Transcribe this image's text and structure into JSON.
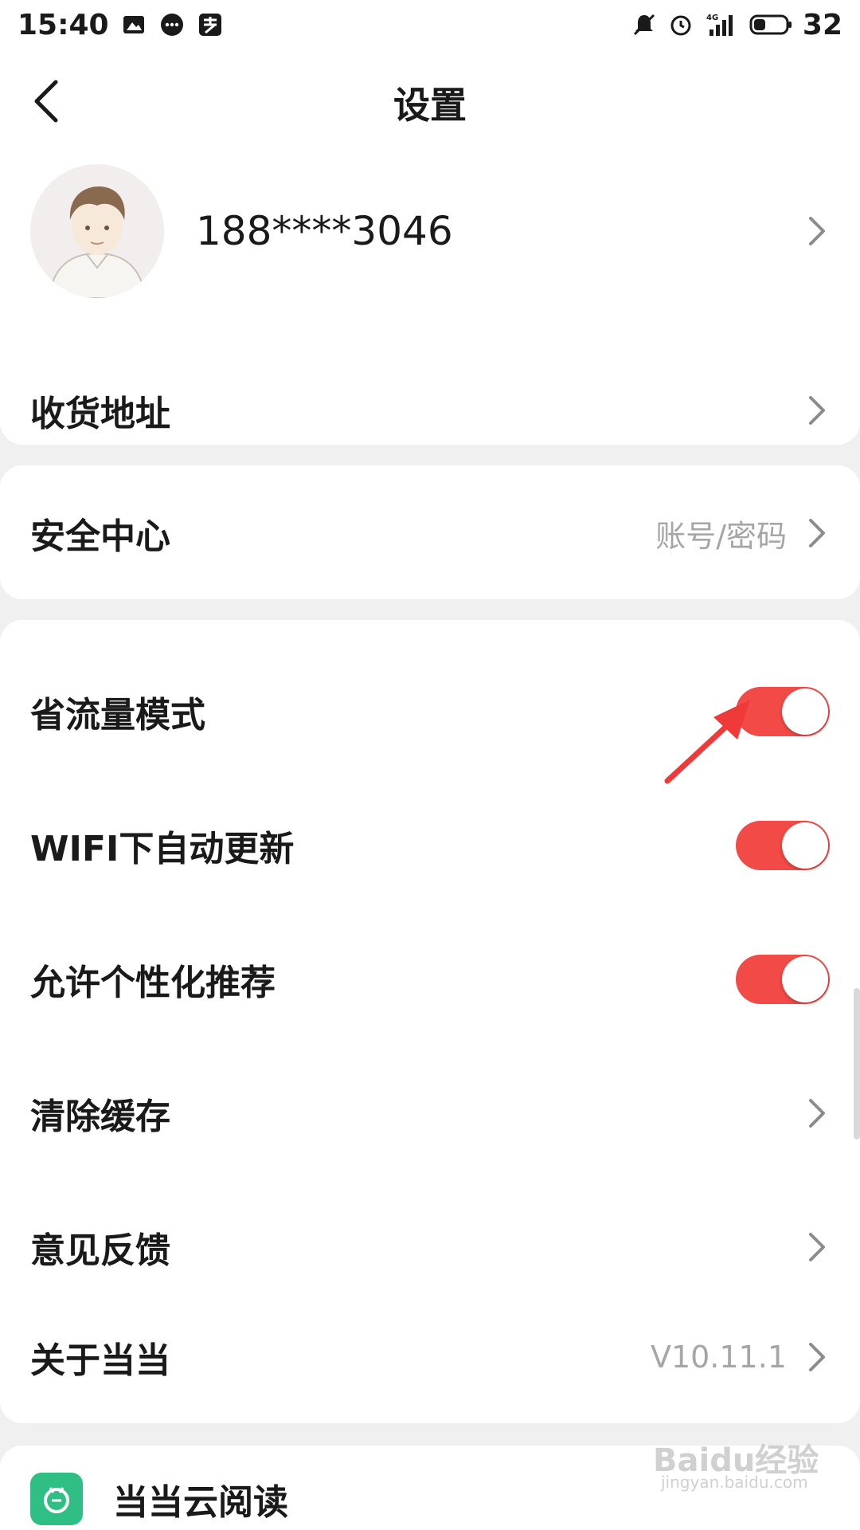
{
  "status_bar": {
    "time": "15:40",
    "battery": "32",
    "left_icons": [
      "image-icon",
      "chat-icon",
      "pay-icon"
    ],
    "right_icons": [
      "mute-icon",
      "alarm-icon",
      "signal-4g-icon",
      "battery-icon"
    ],
    "network": "4G"
  },
  "header": {
    "title": "设置",
    "back_icon": "chevron-left-icon"
  },
  "profile": {
    "phone": "188****3046"
  },
  "rows": {
    "address": {
      "label": "收货地址"
    },
    "security": {
      "label": "安全中心",
      "sub": "账号/密码"
    },
    "data_saver": {
      "label": "省流量模式",
      "enabled": true
    },
    "wifi_update": {
      "label": "WIFI下自动更新",
      "enabled": true
    },
    "personalized": {
      "label": "允许个性化推荐",
      "enabled": true
    },
    "clear_cache": {
      "label": "清除缓存"
    },
    "feedback": {
      "label": "意见反馈"
    },
    "about": {
      "label": "关于当当",
      "sub": "V10.11.1"
    }
  },
  "cloud_reading": {
    "label": "当当云阅读"
  },
  "watermark": {
    "brand": "Baidu经验",
    "url": "jingyan.baidu.com"
  },
  "colors": {
    "toggle_on": "#f24a46",
    "annotation_arrow": "#f03a3a",
    "app_icon_bg": "#2fbf84",
    "background": "#f0f0f0"
  }
}
